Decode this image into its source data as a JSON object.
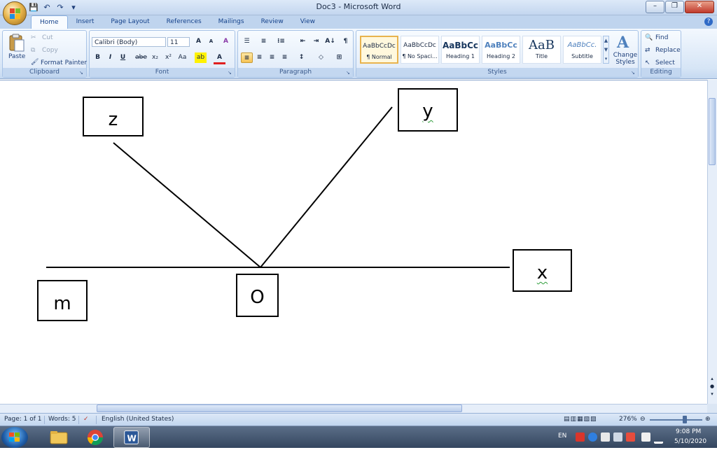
{
  "window": {
    "title": "Doc3 - Microsoft Word",
    "minimize": "–",
    "maximize": "❐",
    "close": "✕"
  },
  "qat": {
    "save": "💾",
    "undo": "↶",
    "redo": "↷",
    "customize": "▾"
  },
  "tabs": [
    "Home",
    "Insert",
    "Page Layout",
    "References",
    "Mailings",
    "Review",
    "View"
  ],
  "help": "?",
  "clipboard": {
    "paste": "Paste",
    "cut": "Cut",
    "copy": "Copy",
    "format_painter": "Format Painter",
    "label": "Clipboard"
  },
  "font": {
    "family": "Calibri (Body)",
    "size": "11",
    "grow": "A",
    "shrink": "A",
    "clear": "A",
    "bold": "B",
    "italic": "I",
    "underline": "U",
    "strike": "abe",
    "subscript": "x₂",
    "superscript": "x²",
    "case": "Aa",
    "highlight": "ab",
    "color": "A",
    "label": "Font"
  },
  "paragraph": {
    "bullets": "☰",
    "numbering": "≡",
    "multilevel": "⁝≡",
    "decrease_indent": "⇤",
    "increase_indent": "⇥",
    "sort": "A↓",
    "show_marks": "¶",
    "align_left": "≡",
    "center": "≡",
    "align_right": "≡",
    "justify": "≡",
    "line_spacing": "↕",
    "shading": "◇",
    "borders": "⊞",
    "label": "Paragraph"
  },
  "styles": {
    "items": [
      {
        "preview": "AaBbCcDc",
        "name": "¶ Normal"
      },
      {
        "preview": "AaBbCcDc",
        "name": "¶ No Spaci..."
      },
      {
        "preview": "AaBbCc",
        "name": "Heading 1"
      },
      {
        "preview": "AaBbCc",
        "name": "Heading 2"
      },
      {
        "preview": "AaB",
        "name": "Title"
      },
      {
        "preview": "AaBbCc.",
        "name": "Subtitle"
      }
    ],
    "change_styles": "Change Styles",
    "label": "Styles"
  },
  "editing": {
    "find": "Find",
    "replace": "Replace",
    "select": "Select",
    "label": "Editing"
  },
  "diagram": {
    "labels": {
      "z": "z",
      "y": "y",
      "x": "x",
      "m": "m",
      "o": "O"
    }
  },
  "status": {
    "page": "Page: 1 of 1",
    "words": "Words: 5",
    "language": "English (United States)",
    "zoom": "276%"
  },
  "taskbar": {
    "lang": "EN",
    "time": "9:08 PM",
    "date": "5/10/2020"
  }
}
